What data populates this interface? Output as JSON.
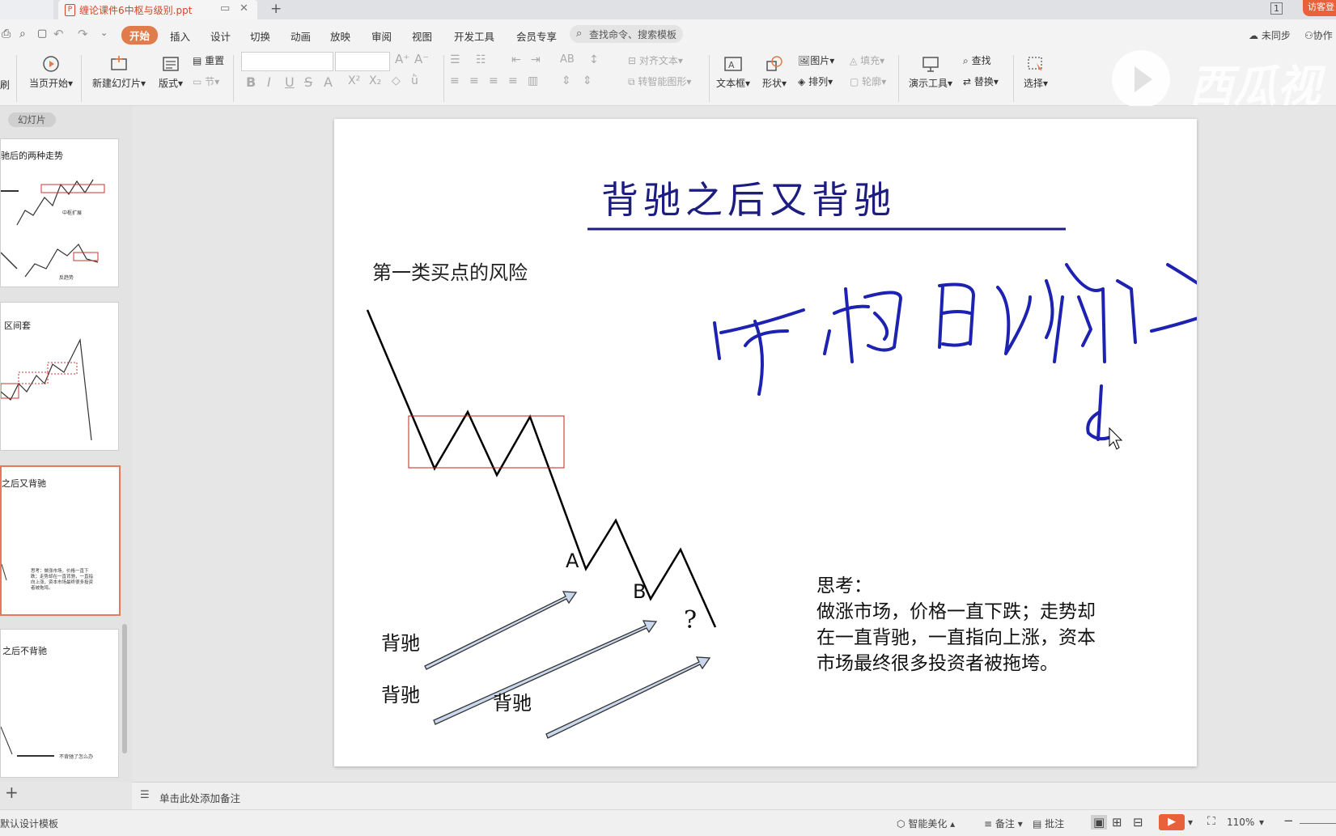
{
  "window": {
    "tab_title": "缠论课件6中枢与级别.ppt",
    "page_indicator": "1",
    "guest_label": "访客登"
  },
  "menu": {
    "items": [
      "开始",
      "插入",
      "设计",
      "切换",
      "动画",
      "放映",
      "审阅",
      "视图",
      "开发工具",
      "会员专享"
    ],
    "active": "开始",
    "search_placeholder": "查找命令、搜索模板",
    "sync_label": "未同步",
    "collab_label": "协作"
  },
  "ribbon": {
    "format_brush": "刷",
    "play_from_current": "当页开始",
    "new_slide": "新建幻灯片",
    "layout": "版式",
    "reset": "重置",
    "section": "节",
    "align_text": "对齐文本",
    "smart_art": "转智能图形",
    "textbox": "文本框",
    "shape": "形状",
    "picture": "图片",
    "arrange": "排列",
    "fill": "填充",
    "outline": "轮廓",
    "presentation_tools": "演示工具",
    "find": "查找",
    "replace": "替换",
    "select": "选择"
  },
  "watermark": "西瓜视",
  "slides_panel": {
    "label": "幻灯片",
    "thumbnails": [
      {
        "title": "驰后的两种走势",
        "caption1": "中枢扩展",
        "caption2": "反趋势"
      },
      {
        "title": "区间套"
      },
      {
        "title": "之后又背驰",
        "note": "思考：做涨市场，价格一直下跌；走势却在一直背驰，一直指向上涨，资本市场最终很多投资者被拖垮。"
      },
      {
        "title": "之后不背驰",
        "caption": "不背驰了怎么办"
      }
    ]
  },
  "slide": {
    "title": "背驰之后又背驰",
    "subtitle": "第一类买点的风险",
    "point_a": "A",
    "point_b": "B",
    "question": "?",
    "divergence_labels": [
      "背驰",
      "背驰",
      "背驰"
    ],
    "think_title": "思考：",
    "think_body": "做涨市场，价格一直下跌；走势却在一直背驰，一直指向上涨，资本市场最终很多投资者被拖垮。",
    "handwriting_color": "#1e22b0",
    "title_color": "#1d1d80"
  },
  "notes": {
    "placeholder": "单击此处添加备注"
  },
  "status": {
    "design_template": "默认设计模板",
    "smart_beautify": "智能美化",
    "notes_btn": "备注",
    "comments_btn": "批注",
    "zoom": "110%"
  }
}
